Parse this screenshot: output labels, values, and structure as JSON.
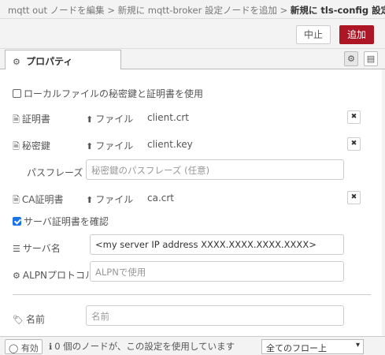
{
  "breadcrumb": {
    "part1": "mqtt out ノードを編集",
    "sep1": " > ",
    "part2": "新規に mqtt-broker 設定ノードを追加",
    "sep2": " > ",
    "current": "新規に tls-config 設定ノードを追加"
  },
  "toolbar": {
    "cancel_label": "中止",
    "done_label": "追加"
  },
  "tabs": {
    "properties_label": "プロパティ"
  },
  "icons": {
    "gear": "⚙",
    "description": "▤",
    "file": "🗎",
    "upload": "⬆",
    "close": "✖",
    "tag": "🏷",
    "info": "ℹ",
    "server": "☰",
    "cogs": "⚙",
    "toggle": "◯",
    "caret": "▾"
  },
  "form": {
    "use_local_files_label": "ローカルファイルの秘密鍵と証明書を使用",
    "use_local_files_checked": false,
    "cert": {
      "label": "証明書",
      "upload_label": "ファイル",
      "filename": "client.crt"
    },
    "key": {
      "label": "秘密鍵",
      "upload_label": "ファイル",
      "filename": "client.key"
    },
    "passphrase": {
      "label": "パスフレーズ",
      "placeholder": "秘密鍵のパスフレーズ (任意)",
      "value": ""
    },
    "ca": {
      "label": "CA証明書",
      "upload_label": "ファイル",
      "filename": "ca.crt"
    },
    "verify_server_label": "サーバ証明書を確認",
    "verify_server_checked": true,
    "servername": {
      "label": "サーバ名",
      "value": "<my server IP address XXXX.XXXX.XXXX.XXXX>"
    },
    "alpn": {
      "label": "ALPNプロトコル",
      "placeholder": "ALPNで使用",
      "value": ""
    },
    "name": {
      "label": "名前",
      "placeholder": "名前",
      "value": ""
    }
  },
  "footer": {
    "enabled_label": "有効",
    "info_text": "0 個のノードが、この設定を使用しています",
    "scope_selected": "全てのフロー上"
  },
  "colors": {
    "accent": "#ad1625",
    "check": "#1a73e8"
  }
}
